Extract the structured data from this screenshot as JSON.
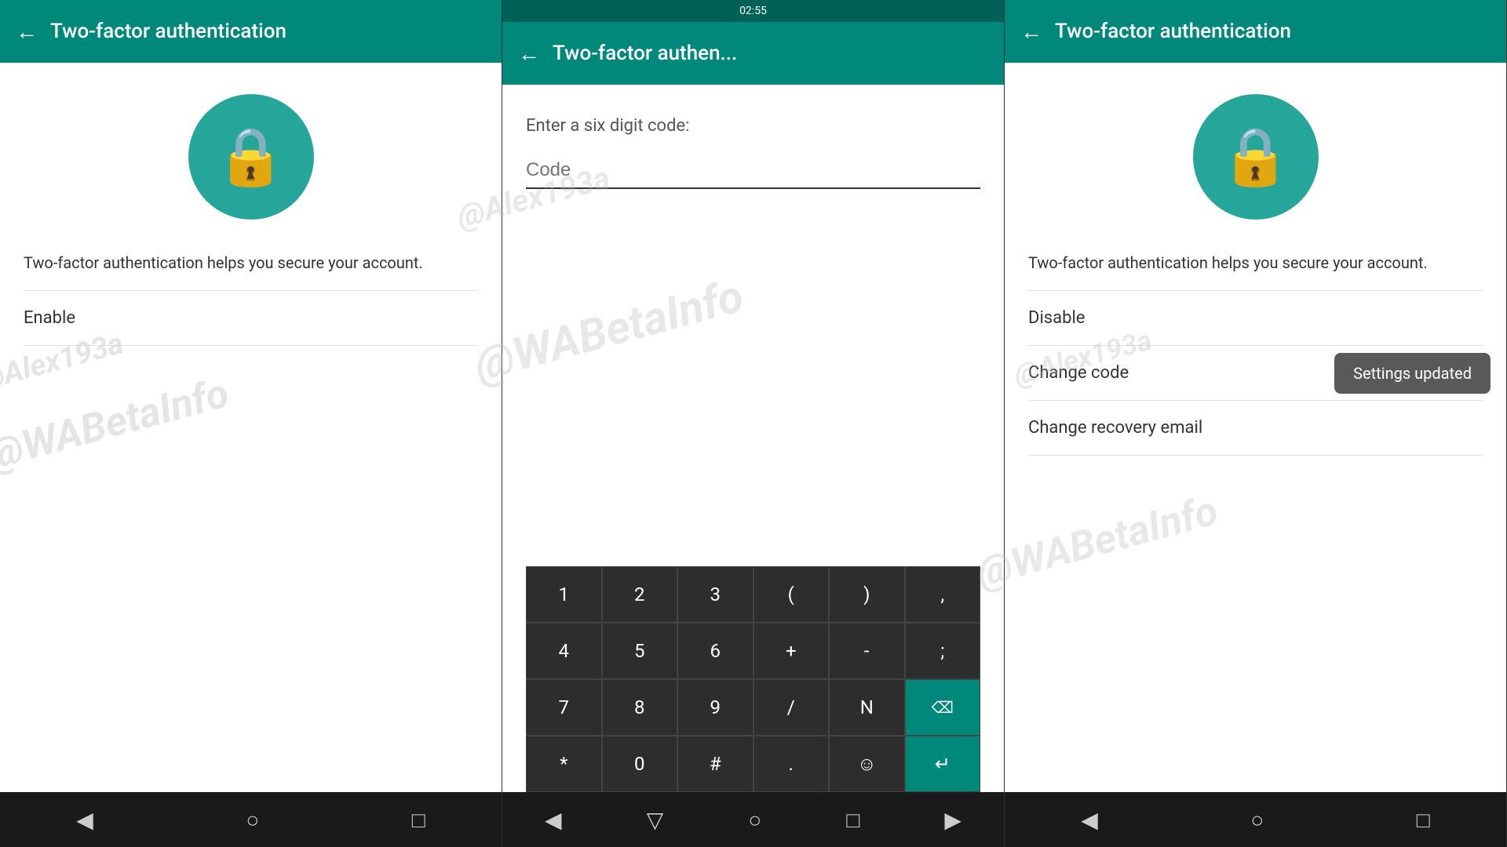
{
  "panel1": {
    "title": "Two-factor authentication",
    "description": "Two-factor authentication helps you secure your account.",
    "menu_item": "Enable",
    "watermark_top": "@Alex193a",
    "watermark_bottom": "@WABetaInfo"
  },
  "panel2": {
    "status_time": "02:55",
    "title": "Two-factor authen...",
    "enter_code_label": "Enter a six digit code:",
    "code_placeholder": "Code",
    "watermark_top": "@Alex193a",
    "watermark_bottom": "@WABetaInfo",
    "keyboard": {
      "rows": [
        [
          "1",
          "2",
          "3",
          "(",
          ")",
          " ,"
        ],
        [
          "4",
          "5",
          "6",
          "+",
          " -",
          " ;"
        ],
        [
          "7",
          "8",
          "9",
          "/",
          " N",
          "⌫"
        ],
        [
          "*",
          "0",
          "#",
          ".",
          " ",
          "↵"
        ]
      ]
    }
  },
  "panel3": {
    "title": "Two-factor authentication",
    "description": "Two-factor authentication helps you secure your account.",
    "snackbar": "Settings updated",
    "menu_items": [
      "Disable",
      "Change code",
      "Change recovery email"
    ],
    "watermark_top": "@Alex193a",
    "watermark_bottom": "@WABetaInfo"
  },
  "nav": {
    "back": "◀",
    "home": "○",
    "recents": "□",
    "forward": "▶"
  }
}
